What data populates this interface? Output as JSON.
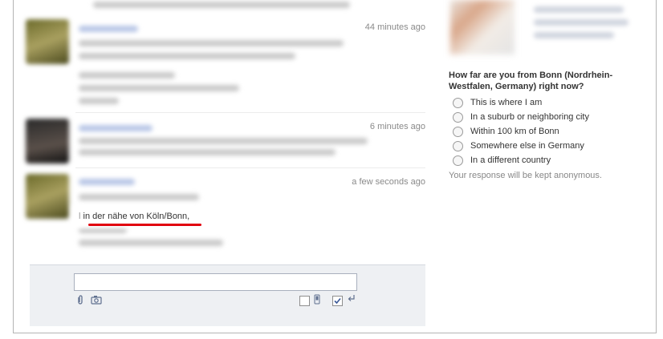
{
  "feed": {
    "timestamps": [
      "44 minutes ago",
      "6 minutes ago",
      "a few seconds ago"
    ],
    "highlighted_text": "in der nähe von Köln/Bonn,",
    "prefix_char": "l"
  },
  "composer": {
    "input_value": ""
  },
  "poll": {
    "question": "How far are you from Bonn (Nordrhein-Westfalen, Germany) right now?",
    "options": [
      "This is where I am",
      "In a suburb or neighboring city",
      "Within 100 km of Bonn",
      "Somewhere else in Germany",
      "In a different country"
    ],
    "note": "Your response will be kept anonymous."
  },
  "colors": {
    "underline": "#e1000f",
    "name_link": "#3b5998"
  }
}
